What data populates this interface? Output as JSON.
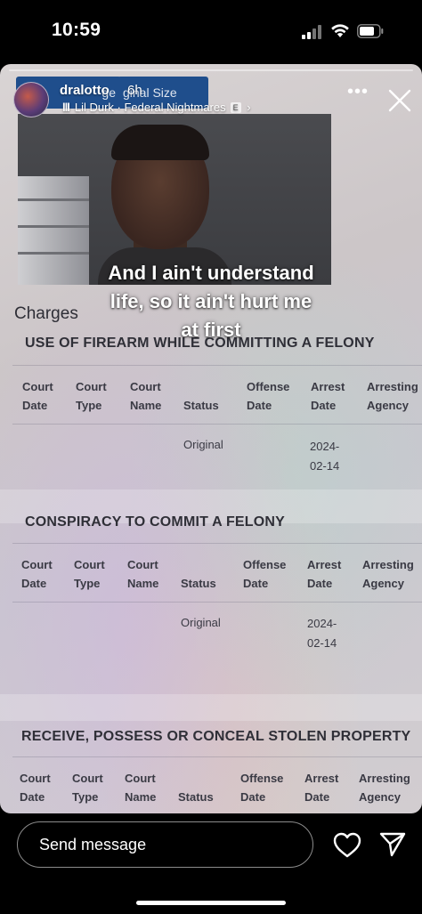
{
  "status_bar": {
    "time": "10:59",
    "icons": [
      "cellular-signal-icon",
      "wifi-icon",
      "battery-icon"
    ]
  },
  "story": {
    "progress": 0.0,
    "username": "dralotto",
    "time_ago": "6h",
    "music": {
      "bars_glyph": "lll",
      "text": "Lil Durk · Federal Nightmares",
      "explicit": "E",
      "chevron": "›"
    },
    "more_glyph": "•••",
    "caption_lines": [
      "And I ain't understand",
      "life, so it ain't hurt me",
      "at first"
    ],
    "document": {
      "buttons": [
        "ge",
        "ginal Size"
      ],
      "charges_heading": "Charges",
      "columns": [
        [
          "Court",
          "Date"
        ],
        [
          "Court",
          "Type"
        ],
        [
          "Court",
          "Name"
        ],
        [
          "Status"
        ],
        [
          "Offense",
          "Date"
        ],
        [
          "Arrest",
          "Date"
        ],
        [
          "Arresting",
          "Agency"
        ]
      ],
      "sections": [
        {
          "title": "USE OF FIREARM WHILE COMMITTING A FELONY",
          "status": "Original",
          "arrest_date": [
            "2024-",
            "02-14"
          ]
        },
        {
          "title": "CONSPIRACY TO COMMIT A FELONY",
          "status": "Original",
          "arrest_date": [
            "2024-",
            "02-14"
          ]
        },
        {
          "title": "RECEIVE, POSSESS OR CONCEAL STOLEN PROPERTY",
          "status": "",
          "arrest_date": []
        }
      ]
    }
  },
  "bottom_bar": {
    "message_placeholder": "Send message"
  },
  "colors": {
    "button_blue": "#1f4e8c",
    "document_text": "#2e2e36"
  }
}
